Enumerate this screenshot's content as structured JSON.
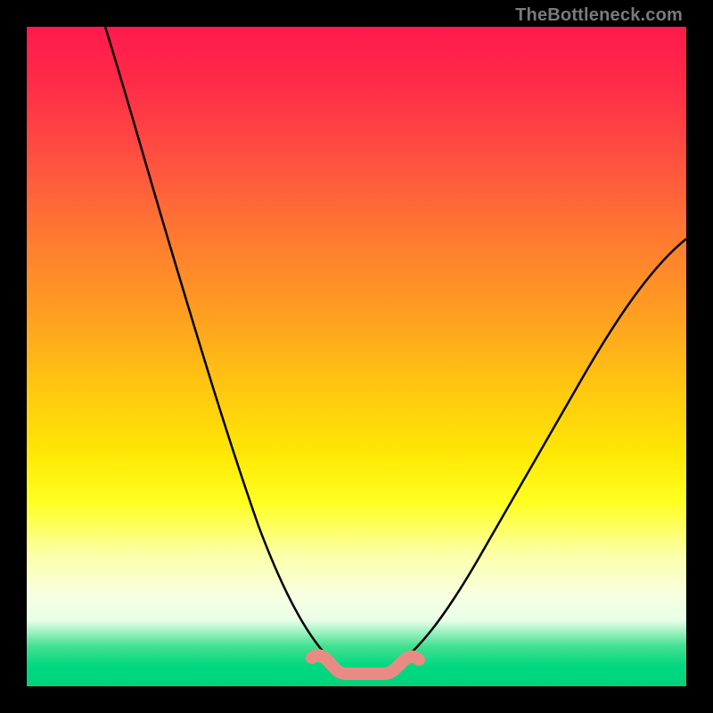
{
  "watermark": "TheBottleneck.com",
  "chart_data": {
    "type": "line",
    "title": "",
    "xlabel": "",
    "ylabel": "",
    "xlim": [
      0,
      100
    ],
    "ylim": [
      0,
      100
    ],
    "series": [
      {
        "name": "left-curve",
        "x": [
          12,
          14,
          16,
          18,
          20,
          22,
          24,
          26,
          28,
          30,
          32,
          34,
          36,
          38,
          40,
          42,
          45,
          48
        ],
        "y": [
          100,
          92,
          84,
          77,
          70,
          63,
          56,
          50,
          44,
          38,
          33,
          28,
          23,
          19,
          15,
          11,
          7,
          4
        ]
      },
      {
        "name": "right-curve",
        "x": [
          55,
          58,
          61,
          64,
          67,
          70,
          73,
          76,
          79,
          82,
          85,
          88,
          91,
          94,
          97,
          100
        ],
        "y": [
          4,
          5,
          7,
          9,
          12,
          15,
          19,
          23,
          27,
          32,
          37,
          42,
          48,
          54,
          60,
          66
        ]
      },
      {
        "name": "bottom-marker",
        "x": [
          43,
          44,
          46,
          48,
          50,
          52,
          54,
          56,
          58,
          59
        ],
        "y": [
          3,
          2,
          2,
          2,
          2,
          2,
          2,
          2,
          2,
          3
        ]
      }
    ],
    "colors": {
      "curve": "#000000",
      "marker": "#e98b85"
    }
  }
}
